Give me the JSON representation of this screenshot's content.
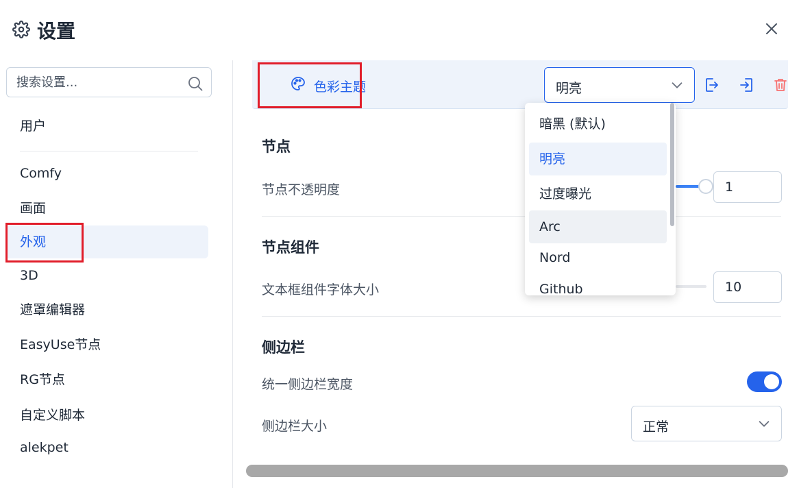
{
  "header": {
    "title": "设置"
  },
  "sidebar": {
    "search_placeholder": "搜索设置...",
    "items": [
      {
        "label": "用户"
      },
      {
        "label": "Comfy"
      },
      {
        "label": "画面"
      },
      {
        "label": "外观",
        "active": true
      },
      {
        "label": "3D"
      },
      {
        "label": "遮罩编辑器"
      },
      {
        "label": "EasyUse节点"
      },
      {
        "label": "RG节点"
      },
      {
        "label": "自定义脚本"
      },
      {
        "label": "alekpet"
      }
    ]
  },
  "main": {
    "theme": {
      "label": "色彩主题",
      "selected": "明亮",
      "options": [
        "暗黑 (默认)",
        "明亮",
        "过度曝光",
        "Arc",
        "Nord",
        "Github"
      ]
    },
    "sections": [
      {
        "title": "节点",
        "settings": [
          {
            "label": "节点不透明度",
            "value": "1",
            "level": 1.0
          }
        ]
      },
      {
        "title": "节点组件",
        "settings": [
          {
            "label": "文本框组件字体大小",
            "value": "10",
            "level": 0.33
          }
        ]
      },
      {
        "title": "侧边栏",
        "settings": [
          {
            "label": "统一侧边栏宽度",
            "toggle": true
          },
          {
            "label": "侧边栏大小",
            "value": "正常"
          }
        ]
      }
    ]
  },
  "colors": {
    "accent": "#2563eb",
    "highlight": "#e11d2a",
    "active_bg": "#eef3fb",
    "danger_icon": "#f87171"
  }
}
